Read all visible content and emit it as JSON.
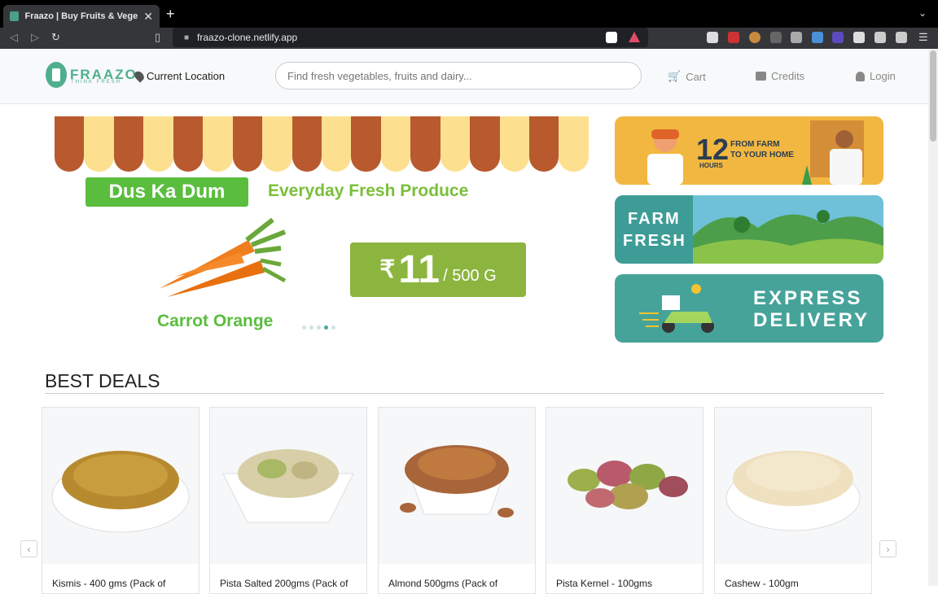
{
  "browser": {
    "tab_title": "Fraazo | Buy Fruits & Vegetables",
    "url": "fraazo-clone.netlify.app"
  },
  "header": {
    "logo_text": "FRAAZO",
    "logo_sub": "THINK FRESH",
    "location_label": "Current Location",
    "search_placeholder": "Find fresh vegetables, fruits and dairy...",
    "cart_label": "Cart",
    "credits_label": "Credits",
    "login_label": "Login"
  },
  "hero": {
    "badge": "Dus Ka Dum",
    "tagline": "Everyday Fresh Produce",
    "product_name": "Carrot Orange",
    "price_currency": "₹",
    "price_value": "11",
    "price_unit": "/ 500 G",
    "active_slide": 4,
    "slide_count": 5
  },
  "banners": {
    "farm_hours_num": "12",
    "farm_hours_label": "HOURS",
    "farm_line1": "FROM FARM",
    "farm_line2": "TO YOUR HOME",
    "farm_fresh_line1": "FARM",
    "farm_fresh_line2": "FRESH",
    "express_line1": "EXPRESS",
    "express_line2": "DELIVERY"
  },
  "deals": {
    "title": "BEST DEALS",
    "items": [
      {
        "name": "Kismis - 400 gms (Pack of"
      },
      {
        "name": "Pista Salted 200gms (Pack of"
      },
      {
        "name": "Almond 500gms (Pack of"
      },
      {
        "name": "Pista Kernel - 100gms"
      },
      {
        "name": "Cashew - 100gm"
      }
    ]
  },
  "colors": {
    "brand_green": "#4fae8f",
    "hero_green": "#5abd3e",
    "price_green": "#8bb53e",
    "banner_teal": "#46a39a",
    "banner_yellow": "#f2b740"
  }
}
